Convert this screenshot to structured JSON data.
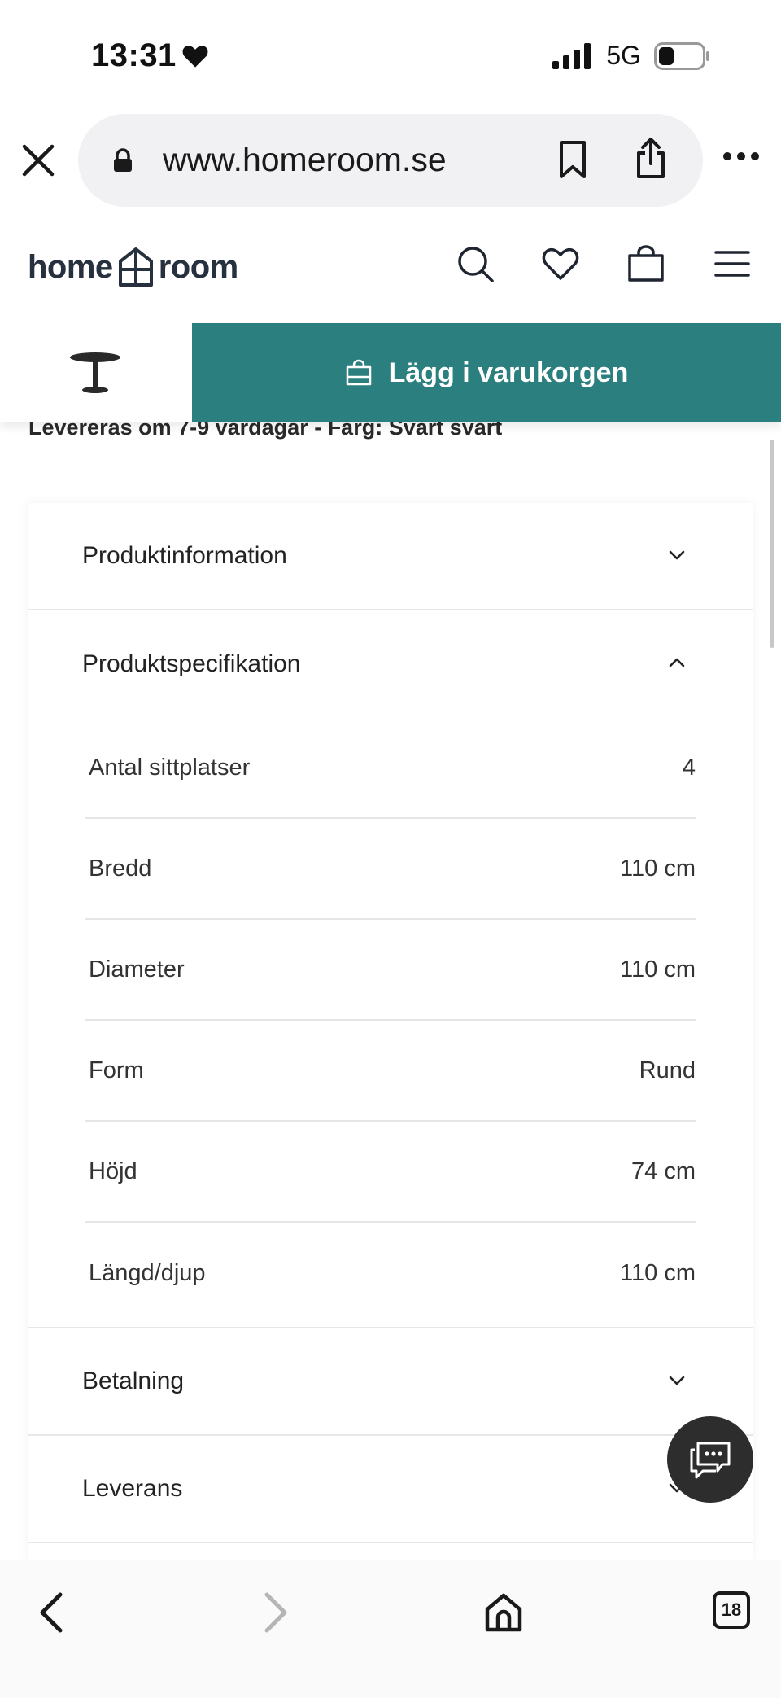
{
  "status_bar": {
    "time": "13:31",
    "network": "5G"
  },
  "browser": {
    "url": "www.homeroom.se"
  },
  "site": {
    "logo_left": "home",
    "logo_right": "room"
  },
  "sticky_bar": {
    "add_to_cart_label": "Lägg i varukorgen"
  },
  "delivery_info": "Levereras om 7-9 vardagar - Färg: Svart svart",
  "accordion": {
    "product_info": "Produktinformation",
    "product_spec": "Produktspecifikation",
    "payment": "Betalning",
    "delivery": "Leverans"
  },
  "specs": [
    {
      "label": "Antal sittplatser",
      "value": "4"
    },
    {
      "label": "Bredd",
      "value": "110 cm"
    },
    {
      "label": "Diameter",
      "value": "110 cm"
    },
    {
      "label": "Form",
      "value": "Rund"
    },
    {
      "label": "Höjd",
      "value": "74 cm"
    },
    {
      "label": "Längd/djup",
      "value": "110 cm"
    }
  ],
  "toolbar": {
    "tab_count": "18"
  },
  "colors": {
    "accent": "#2b7f7e",
    "chat_bg": "#2d2d2d"
  }
}
